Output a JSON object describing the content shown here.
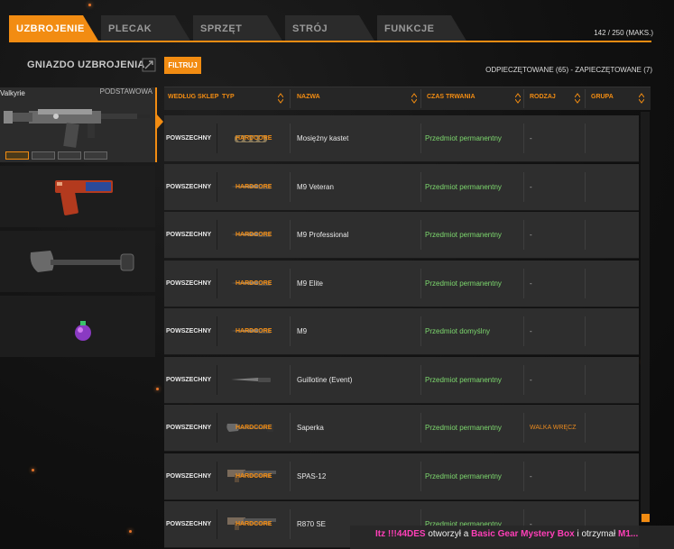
{
  "tabs": [
    {
      "label": "UZBROJENIE",
      "active": true
    },
    {
      "label": "PLECAK",
      "active": false
    },
    {
      "label": "SPRZĘT",
      "active": false
    },
    {
      "label": "STRÓJ",
      "active": false
    },
    {
      "label": "FUNKCJE",
      "active": false
    }
  ],
  "capacity": "142 / 250 (MAKS.)",
  "slot_panel": {
    "title": "GNIAZDO UZBROJENIA",
    "filter_label": "FILTRUJ",
    "unlock_status": "ODPIECZĘTOWANE (65) - ZAPIECZĘTOWANE (7)"
  },
  "slots": [
    {
      "name": "Valkyrie",
      "category": "PODSTAWOWA",
      "icon": "assault-rifle-icon"
    },
    {
      "name": "",
      "category": "",
      "icon": "pistol-icon"
    },
    {
      "name": "",
      "category": "",
      "icon": "shovel-icon"
    },
    {
      "name": "",
      "category": "",
      "icon": "grenade-icon"
    }
  ],
  "table": {
    "headers": [
      "WEDŁUG SKLEP",
      "TYP",
      "NAZWA",
      "CZAS TRWANIA",
      "RODZAJ",
      "GRUPA"
    ],
    "rows": [
      {
        "generation": "POWSZECHNY",
        "type": "HARDCORE",
        "name": "Mosiężny kastet",
        "duration": "Przedmiot permanentny",
        "kind": "-",
        "group": "",
        "thumb": "knuckles-icon"
      },
      {
        "generation": "POWSZECHNY",
        "type": "HARDCORE",
        "name": "M9 Veteran",
        "duration": "Przedmiot permanentny",
        "kind": "-",
        "group": "",
        "thumb": "knife-icon"
      },
      {
        "generation": "POWSZECHNY",
        "type": "HARDCORE",
        "name": "M9 Professional",
        "duration": "Przedmiot permanentny",
        "kind": "-",
        "group": "",
        "thumb": "knife-icon"
      },
      {
        "generation": "POWSZECHNY",
        "type": "HARDCORE",
        "name": "M9 Elite",
        "duration": "Przedmiot permanentny",
        "kind": "-",
        "group": "",
        "thumb": "knife-icon"
      },
      {
        "generation": "POWSZECHNY",
        "type": "HARDCORE",
        "name": "M9",
        "duration": "Przedmiot domyślny",
        "kind": "-",
        "group": "",
        "thumb": "knife-icon"
      },
      {
        "generation": "POWSZECHNY",
        "type": "",
        "name": "Guillotine (Event)",
        "duration": "Przedmiot permanentny",
        "kind": "-",
        "group": "",
        "thumb": "knife-icon"
      },
      {
        "generation": "POWSZECHNY",
        "type": "HARDCORE",
        "name": "Saperka",
        "duration": "Przedmiot permanentny",
        "kind": "WALKA WRĘCZ",
        "group": "",
        "thumb": "shovel-icon"
      },
      {
        "generation": "POWSZECHNY",
        "type": "HARDCORE",
        "name": "SPAS-12",
        "duration": "Przedmiot permanentny",
        "kind": "-",
        "group": "",
        "thumb": "shotgun-icon"
      },
      {
        "generation": "POWSZECHNY",
        "type": "HARDCORE",
        "name": "R870 SE",
        "duration": "Przedmiot permanentny",
        "kind": "-",
        "group": "",
        "thumb": "shotgun-icon"
      }
    ]
  },
  "notification": {
    "player": "Itz !!!44DES",
    "text1": "otworzył a",
    "item": "Basic Gear Mystery Box",
    "text2": "i otrzymał",
    "reward": "M1..."
  },
  "colors": {
    "accent": "#f28c12",
    "permanent": "#7dd96e",
    "highlight": "#ff3fb8"
  }
}
